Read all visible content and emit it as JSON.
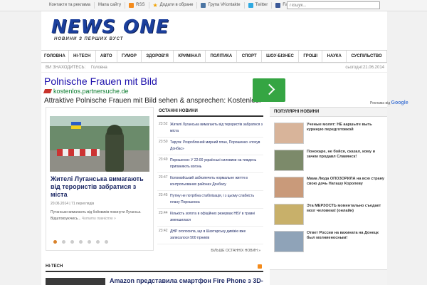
{
  "topbar": {
    "links": [
      {
        "label": "Контакти та реклама",
        "icon": ""
      },
      {
        "label": "Мапа сайту",
        "icon": ""
      },
      {
        "label": "RSS",
        "icon": "rss-icon"
      },
      {
        "label": "Додати в обране",
        "icon": "star-icon"
      },
      {
        "label": "Група VKontakte",
        "icon": "vk-icon"
      },
      {
        "label": "Twitter",
        "icon": "twitter-icon"
      },
      {
        "label": "Facebook",
        "icon": "facebook-icon"
      }
    ],
    "search_placeholder": "Пошук..."
  },
  "logo": {
    "title": "NEWS ONE",
    "subtitle": "НОВИНИ З ПЕРШИХ ВУСТ",
    "color": "#1b3f9c"
  },
  "nav": [
    "ГОЛОВНА",
    "HI-TECH",
    "АВТО",
    "ГУМОР",
    "ЗДОРОВ'Я",
    "КРИМІНАЛ",
    "ПОЛІТИКА",
    "СПОРТ",
    "ШОУ-БІЗНЕС",
    "ГРОШІ",
    "НАУКА",
    "СУСПІЛЬСТВО"
  ],
  "breadcrumb": {
    "prefix": "ВИ ЗНАХОДИТЕСЬ:",
    "current": "Головна",
    "date": "сьогодні:21.06.2014"
  },
  "ad": {
    "title": "Polnische Frauen mit Bild",
    "url": "kostenlos.partnersuche.de",
    "desc": "Attraktive Polnische Frauen mit Bild sehen & ansprechen: Kostenlos!",
    "tag_prefix": "Реклама від",
    "tag_brand": "Google"
  },
  "featured": {
    "title": "Жителі Луганська вимагають від терористів забратися з міста",
    "meta": "20.06.2014  |  71 переглядів",
    "excerpt": "Путанськи вимагають від бойовиків покинути Луганськ. Відштовхуючись...",
    "more": "Читати повністю »"
  },
  "latest": {
    "heading": "ОСТАННІ НОВИНИ",
    "items": [
      {
        "time": "23:52",
        "text": "Жителі Луганська вимагають від терористів забратися з міста"
      },
      {
        "time": "23:50",
        "text": "Таруга: Розроблений мирний план, Порошенко «почув Донбас»"
      },
      {
        "time": "23:49",
        "text": "Порошенко: У 22:00 українські силовики на тиждень припиняють вогонь"
      },
      {
        "time": "23:47",
        "text": "Коломойський забезпечить нормальне життя в контрольованих районах Донбасу"
      },
      {
        "time": "23:45",
        "text": "Путіну не потрібна стабілізація, і з цьому слабкість плану Порошенка"
      },
      {
        "time": "23:44",
        "text": "Кількість золота в офіційних резервах НБУ в травні зменшилася"
      },
      {
        "time": "23:42",
        "text": "ДНР оголосила, що в Шахтарську дивізію вже записалося 500 гірників"
      }
    ],
    "more": "БІЛЬШЕ ОСТАННІХ НОВИН »"
  },
  "popular": {
    "heading": "ПОПУЛЯРНІ НОВИНИ",
    "items": [
      {
        "text": "Ученые молят: НЕ ааршыте выть куриную передготовкой",
        "color": "#d8b49a"
      },
      {
        "text": "Понохаре, не бойся, сказал, кому и зачем продавл Славянск!",
        "color": "#7c8a6a"
      },
      {
        "text": "Мама Люда ОПОЗОРИЛА на всю страну свою дочь Наташу Королеву",
        "color": "#c99a7a"
      },
      {
        "text": "Эта МЕРЗОСТЬ моментально съедает мозг человека! (онлайн)",
        "color": "#c8b06a"
      },
      {
        "text": "Ответ России на вахината на Донецк был молниеносным!",
        "color": "#8fa3b8"
      }
    ]
  },
  "hitech": {
    "heading": "HI-TECH",
    "title": "Amazon представила смартфон Fire Phone з 3D-"
  }
}
